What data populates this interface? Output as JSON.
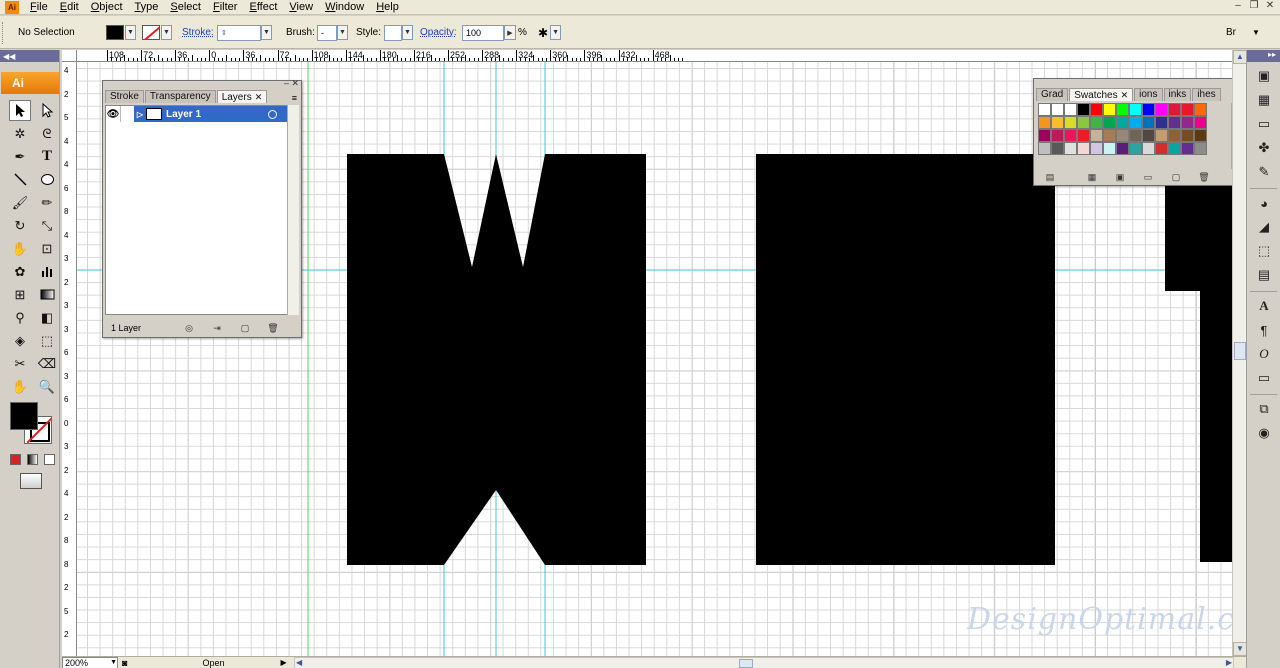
{
  "menu": {
    "items": [
      "File",
      "Edit",
      "Object",
      "Type",
      "Select",
      "Filter",
      "Effect",
      "View",
      "Window",
      "Help"
    ]
  },
  "control_bar": {
    "selection_text": "No Selection",
    "stroke_label": "Stroke:",
    "brush_label": "Brush:",
    "brush_value": "-",
    "style_label": "Style:",
    "opacity_label": "Opacity:",
    "opacity_value": "100",
    "opacity_unit": "%",
    "br_label": "Br"
  },
  "tools": {
    "logo": "Ai"
  },
  "hruler": {
    "labels": [
      "108",
      "72",
      "36",
      "0",
      "36",
      "72",
      "108",
      "144",
      "180",
      "216",
      "252",
      "288",
      "324",
      "360",
      "396",
      "432",
      "468"
    ]
  },
  "vruler": {
    "labels": [
      "4",
      "2",
      "5",
      "4",
      "4",
      "6",
      "8",
      "4",
      "3",
      "2",
      "3",
      "3",
      "6",
      "3",
      "6",
      "0",
      "3",
      "2",
      "4",
      "2",
      "8",
      "8",
      "2",
      "5",
      "2"
    ]
  },
  "layers_panel": {
    "tabs": [
      "Stroke",
      "Transparency",
      "Layers"
    ],
    "layer_name": "Layer 1",
    "footer_text": "1 Layer"
  },
  "swatches_panel": {
    "tabs": [
      "Grad",
      "Swatches",
      "ions",
      "inks",
      "ihes"
    ],
    "colors": [
      "#ffffff",
      "#ffffff",
      "#ffffff",
      "#000000",
      "#ff0000",
      "#ffff00",
      "#00ff00",
      "#00ffff",
      "#0000ff",
      "#ff00ff",
      "#e0163c",
      "#e8182a",
      "#ff6a00",
      "#f7941d",
      "#fdbb2f",
      "#d6de23",
      "#8dc63f",
      "#39b54a",
      "#00a651",
      "#00a99d",
      "#00aeef",
      "#0072bc",
      "#2e3192",
      "#662d91",
      "#92278f",
      "#ec008c",
      "#9e005d",
      "#c2185b",
      "#ed145b",
      "#ed1c24",
      "#c7b299",
      "#a67c52",
      "#998675",
      "#736357",
      "#534741",
      "#c69c6d",
      "#8c6239",
      "#754c24",
      "#603913",
      "#bfbfbf",
      "#595959",
      "#e0e0e0",
      "#f2d7d5",
      "#d4c4e4",
      "#ccf2f2",
      "#5a1d7a",
      "#2ea3a3",
      "#d9d9d9",
      "#d12e2e",
      "#00a99d",
      "#662d91",
      "#8c8c8c"
    ]
  },
  "status_bar": {
    "zoom": "200%",
    "status": "Open"
  },
  "canvas": {
    "watermark": "DesignOptimal.com"
  }
}
